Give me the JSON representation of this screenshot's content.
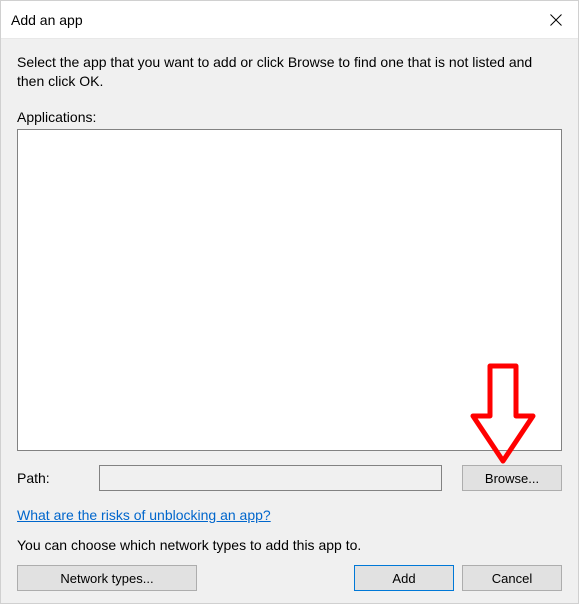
{
  "window": {
    "title": "Add an app"
  },
  "instruction": "Select the app that you want to add or click Browse to find one that is not listed and then click OK.",
  "applications_label": "Applications:",
  "path_label": "Path:",
  "path_value": "",
  "buttons": {
    "browse": "Browse...",
    "network_types": "Network types...",
    "add": "Add",
    "cancel": "Cancel"
  },
  "risks_link": "What are the risks of unblocking an app?",
  "network_text": "You can choose which network types to add this app to.",
  "annotation": {
    "color": "#ff0000",
    "type": "down-arrow"
  }
}
